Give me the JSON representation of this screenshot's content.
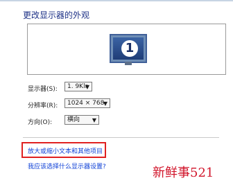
{
  "title": "更改显示器的外观",
  "preview": {
    "monitor_number": "1"
  },
  "settings": [
    {
      "label": "显示器(S):",
      "value": "1. 9Klr"
    },
    {
      "label": "分辨率(R):",
      "value": "1024 × 768"
    },
    {
      "label": "方向(O):",
      "value": "横向"
    }
  ],
  "links": {
    "make_text_larger": "放大或缩小文本和其他项目",
    "which_settings": "我应该选择什么显示器设置?"
  },
  "watermark": "新鲜事521"
}
